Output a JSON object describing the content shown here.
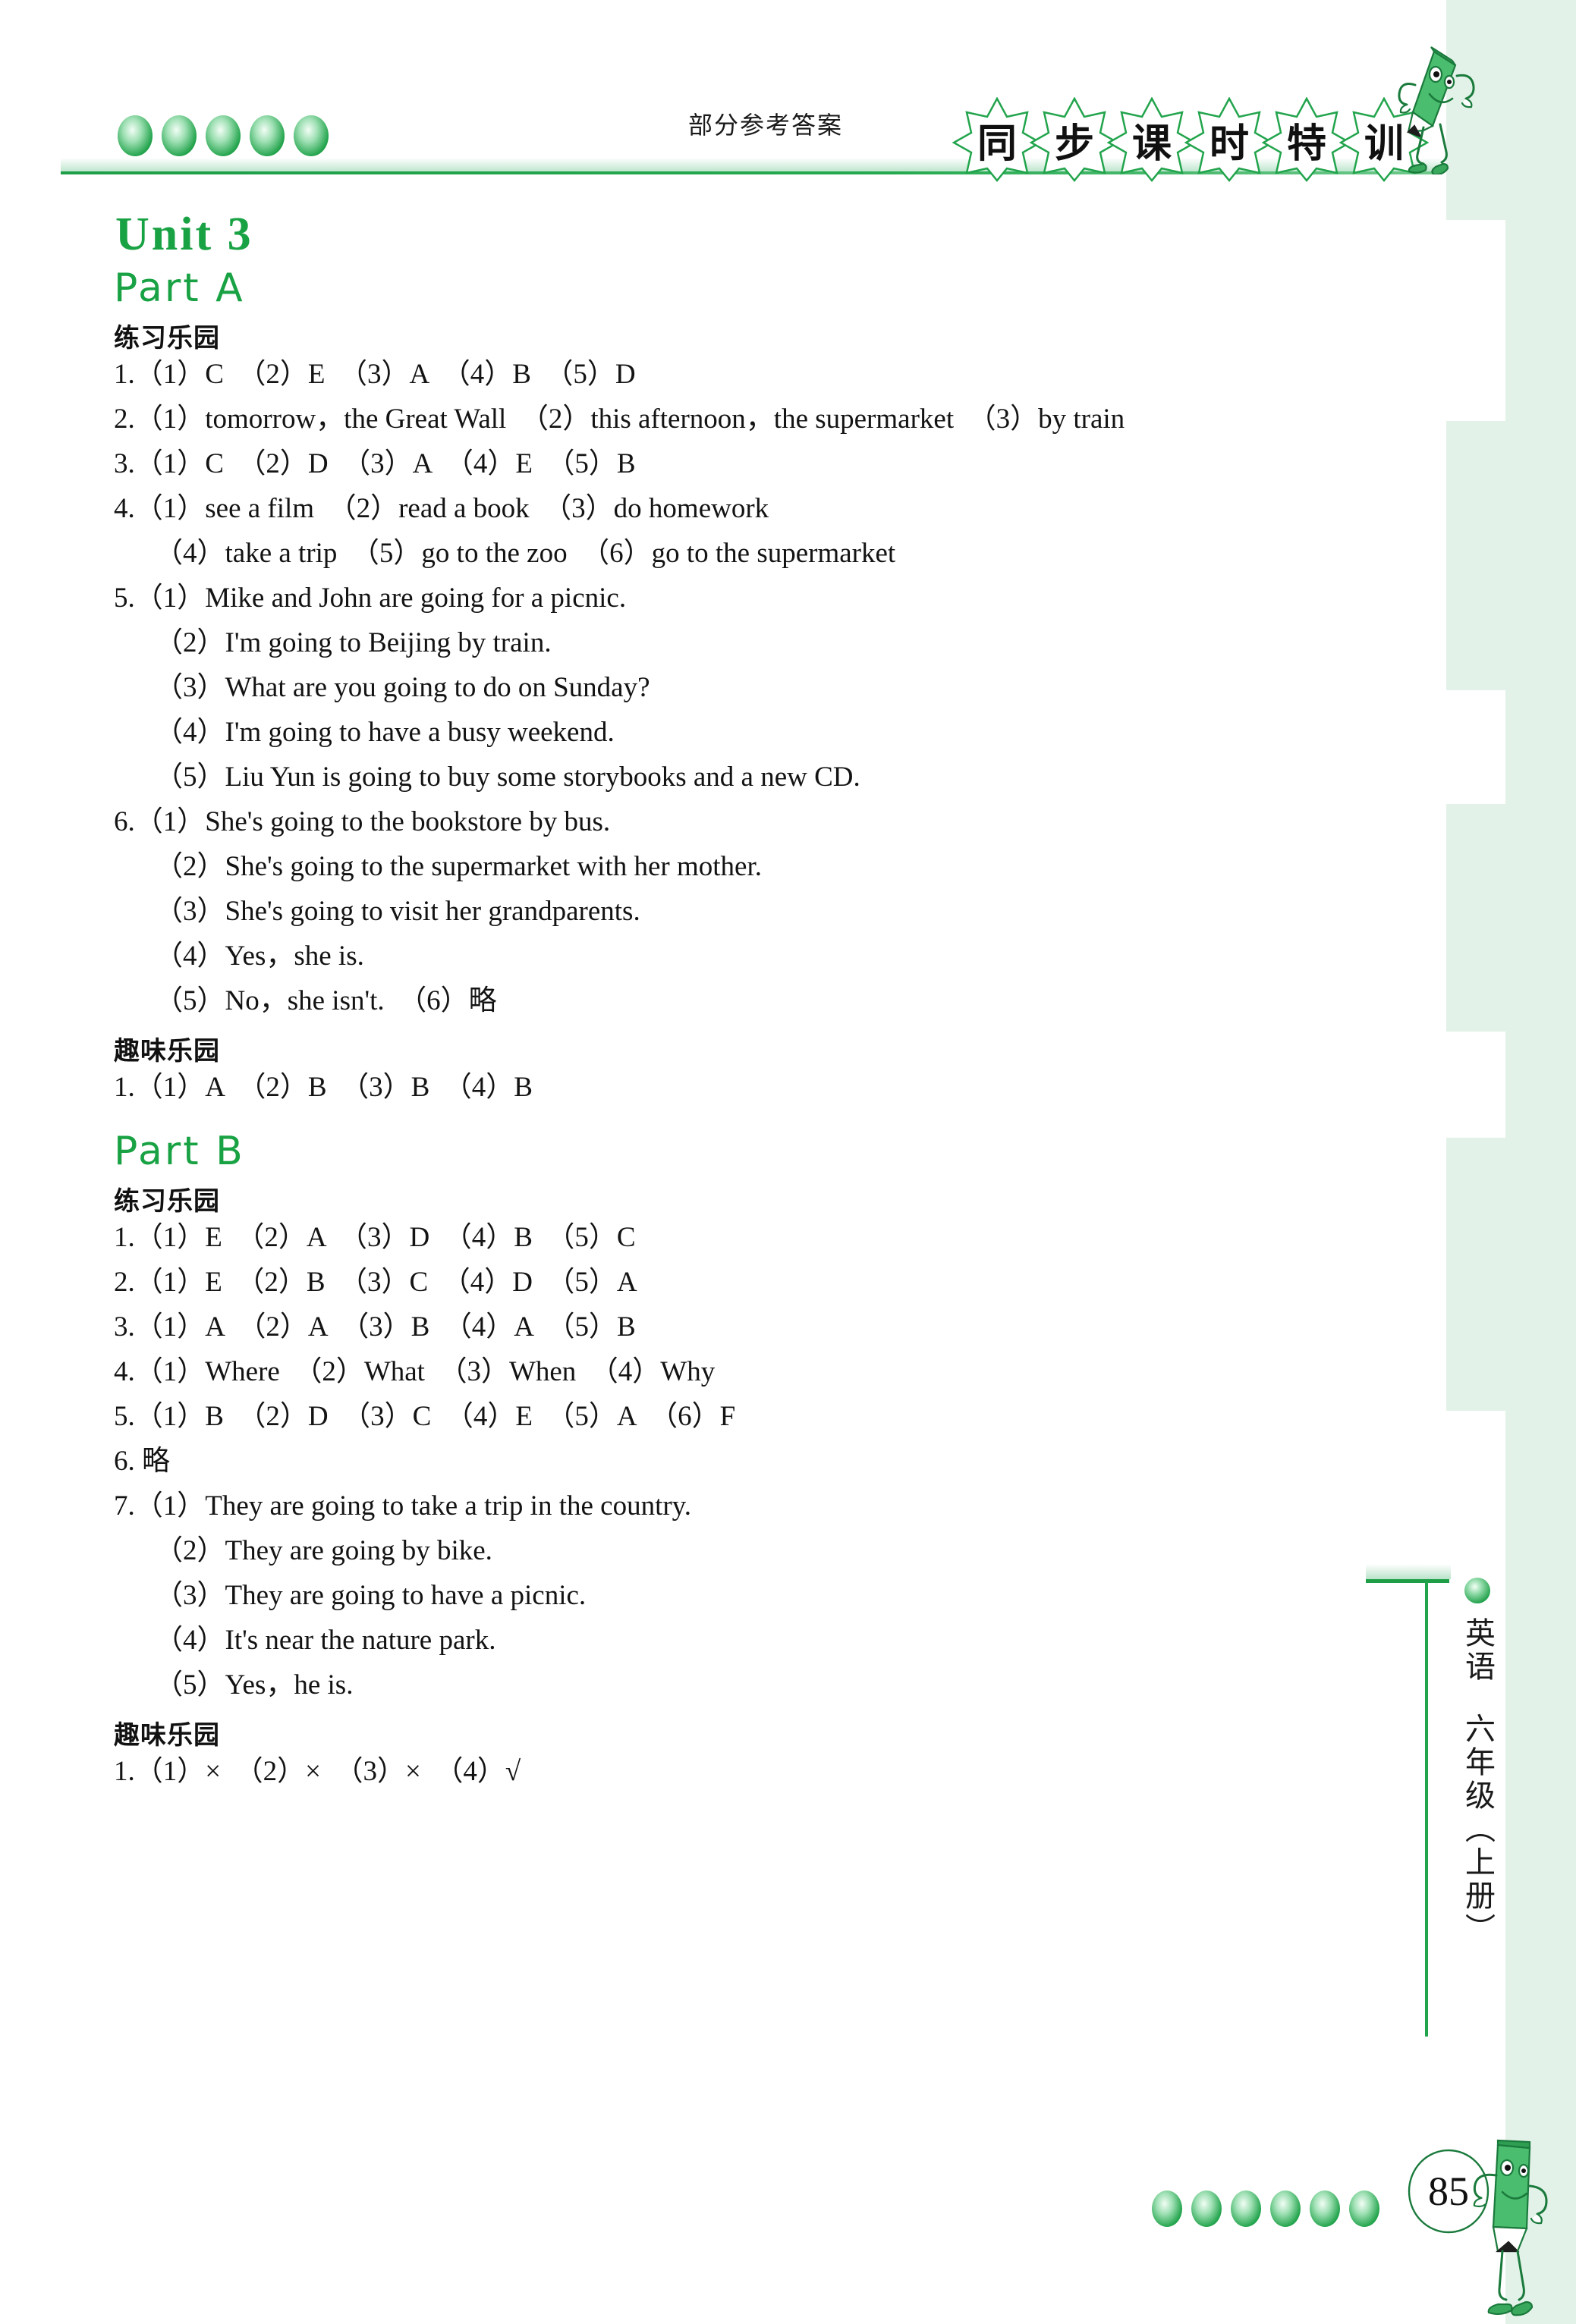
{
  "header": {
    "label": "部分参考答案",
    "title_chars": [
      "同",
      "步",
      "课",
      "时",
      "特",
      "训"
    ],
    "mascot": "pencil-mascot"
  },
  "sidebar": {
    "subject": "英语",
    "grade": "六年级（上册）"
  },
  "footer": {
    "page_number": "85"
  },
  "content": {
    "unit_title": "Unit 3",
    "sections": [
      {
        "part_label": "Part A",
        "groups": [
          {
            "heading": "练习乐园",
            "lines": [
              {
                "text": "1.（1）C　（2）E　（3）A　（4）B　（5）D",
                "indent": false
              },
              {
                "text": "2.（1）tomorrow，the Great Wall　（2）this afternoon，the supermarket　（3）by train",
                "indent": false
              },
              {
                "text": "3.（1）C　（2）D　（3）A　（4）E　（5）B",
                "indent": false
              },
              {
                "text": "4.（1）see a film　（2）read a book　（3）do homework",
                "indent": false
              },
              {
                "text": "（4）take a trip　（5）go to the zoo　（6）go to the supermarket",
                "indent": true
              },
              {
                "text": "5.（1）Mike and John are going for a picnic.",
                "indent": false
              },
              {
                "text": "（2）I'm going to Beijing by train.",
                "indent": true
              },
              {
                "text": "（3）What are you going to do on Sunday?",
                "indent": true
              },
              {
                "text": "（4）I'm going to have a busy weekend.",
                "indent": true
              },
              {
                "text": "（5）Liu Yun is going to buy some storybooks and a new CD.",
                "indent": true
              },
              {
                "text": "6.（1）She's going to the bookstore by bus.",
                "indent": false
              },
              {
                "text": "（2）She's going to the supermarket with her mother.",
                "indent": true
              },
              {
                "text": "（3）She's going to visit her grandparents.",
                "indent": true
              },
              {
                "text": "（4）Yes，she is.",
                "indent": true
              },
              {
                "text": "（5）No，she isn't.　（6）略",
                "indent": true
              }
            ]
          },
          {
            "heading": "趣味乐园",
            "lines": [
              {
                "text": "1.（1）A　（2）B　（3）B　（4）B",
                "indent": false
              }
            ]
          }
        ]
      },
      {
        "part_label": "Part B",
        "groups": [
          {
            "heading": "练习乐园",
            "lines": [
              {
                "text": "1.（1）E　（2）A　（3）D　（4）B　（5）C",
                "indent": false
              },
              {
                "text": "2.（1）E　（2）B　（3）C　（4）D　（5）A",
                "indent": false
              },
              {
                "text": "3.（1）A　（2）A　（3）B　（4）A　（5）B",
                "indent": false
              },
              {
                "text": "4.（1）Where　（2）What　（3）When　（4）Why",
                "indent": false
              },
              {
                "text": "5.（1）B　（2）D　（3）C　（4）E　（5）A　（6）F",
                "indent": false
              },
              {
                "text": "6. 略",
                "indent": false
              },
              {
                "text": "7.（1）They are going to take a trip in the country.",
                "indent": false
              },
              {
                "text": "（2）They are going by bike.",
                "indent": true
              },
              {
                "text": "（3）They are going to have a picnic.",
                "indent": true
              },
              {
                "text": "（4）It's near the nature park.",
                "indent": true
              },
              {
                "text": "（5）Yes，he is.",
                "indent": true
              }
            ]
          },
          {
            "heading": "趣味乐园",
            "lines": [
              {
                "text": "1.（1）×　（2）×　（3）×　（4）√",
                "indent": false
              }
            ]
          }
        ]
      }
    ]
  },
  "colors": {
    "green": "#19a244",
    "rule_green": "#1d9e47",
    "edge_mint": "#e3f2e8",
    "text_black": "#131313"
  }
}
